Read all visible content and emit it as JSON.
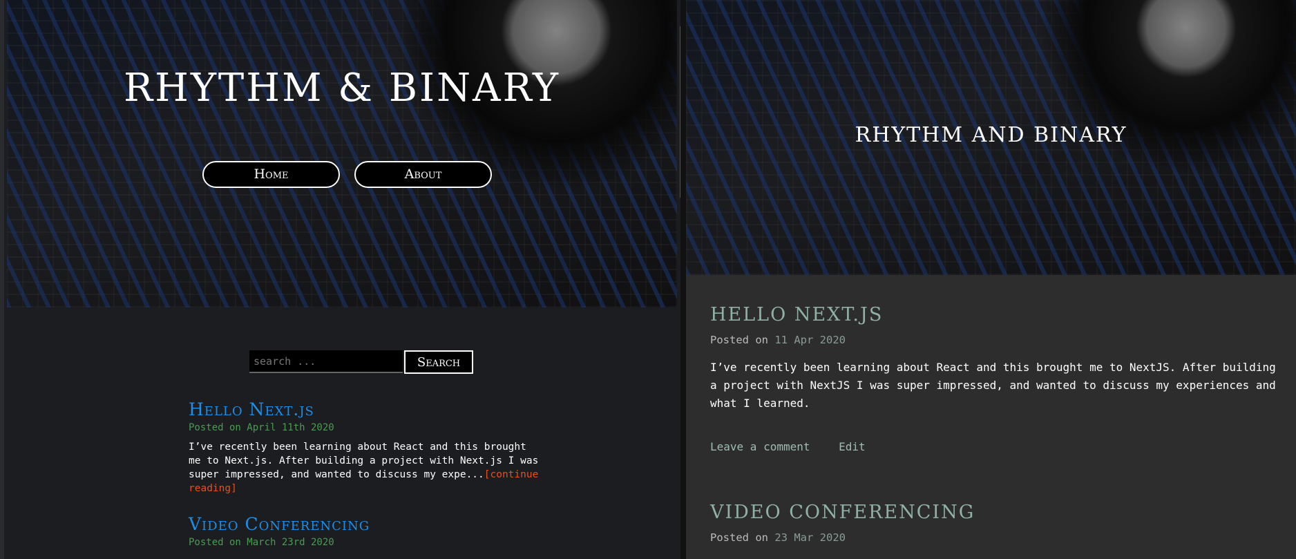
{
  "left": {
    "site_title": "RHYTHM & BINARY",
    "nav": [
      "Home",
      "About"
    ],
    "search": {
      "placeholder": "search ...",
      "button": "Search"
    },
    "posts": [
      {
        "title": "Hello Next.js",
        "date": "Posted on April 11th 2020",
        "excerpt": "I’ve recently been learning about React and this brought me to Next.js. After building a project with Next.js I was super impressed, and wanted to discuss my expe...",
        "more": "[continue reading]"
      },
      {
        "title": "Video Conferencing",
        "date": "Posted on March 23rd 2020"
      }
    ]
  },
  "right": {
    "site_title": "RHYTHM AND BINARY",
    "posts": [
      {
        "title": "HELLO NEXT.JS",
        "posted": "Posted on",
        "date": "11 Apr 2020",
        "body": "I’ve recently been learning about React and this brought me to NextJS. After building a project with NextJS I was super impressed, and wanted to discuss my experiences and what I learned.",
        "comment": "Leave a comment",
        "edit": "Edit"
      },
      {
        "title": "VIDEO CONFERENCING",
        "posted": "Posted on",
        "date": "23 Mar 2020"
      }
    ]
  }
}
